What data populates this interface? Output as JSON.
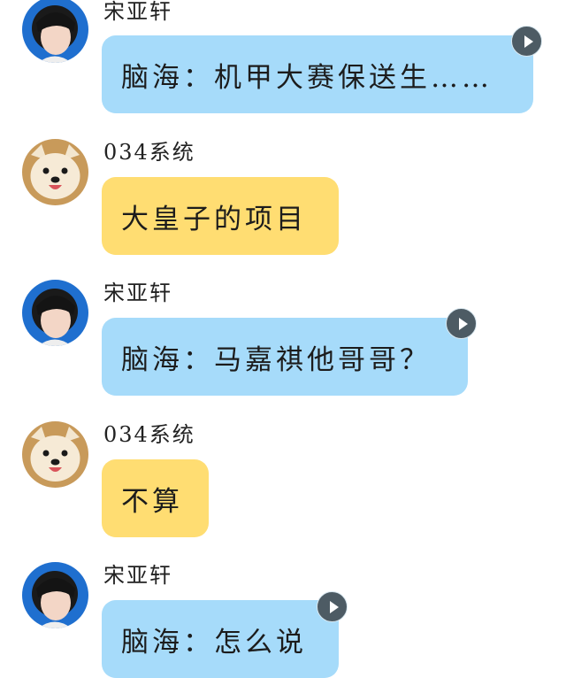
{
  "messages": [
    {
      "sender": "宋亚轩",
      "avatar": "boy-avatar",
      "text": "脑海：机甲大赛保送生……",
      "bubble_color": "#a6dbfa",
      "voice_play": true
    },
    {
      "sender": "034系统",
      "avatar": "dog-avatar",
      "text": "大皇子的项目",
      "bubble_color": "#ffdd72",
      "voice_play": false
    },
    {
      "sender": "宋亚轩",
      "avatar": "boy-avatar",
      "text": "脑海：马嘉祺他哥哥？",
      "bubble_color": "#a6dbfa",
      "voice_play": true
    },
    {
      "sender": "034系统",
      "avatar": "dog-avatar",
      "text": "不算",
      "bubble_color": "#ffdd72",
      "voice_play": false
    },
    {
      "sender": "宋亚轩",
      "avatar": "boy-avatar",
      "text": "脑海：怎么说",
      "bubble_color": "#a6dbfa",
      "voice_play": true
    }
  ],
  "icons": {
    "voice_play": "play-icon"
  }
}
